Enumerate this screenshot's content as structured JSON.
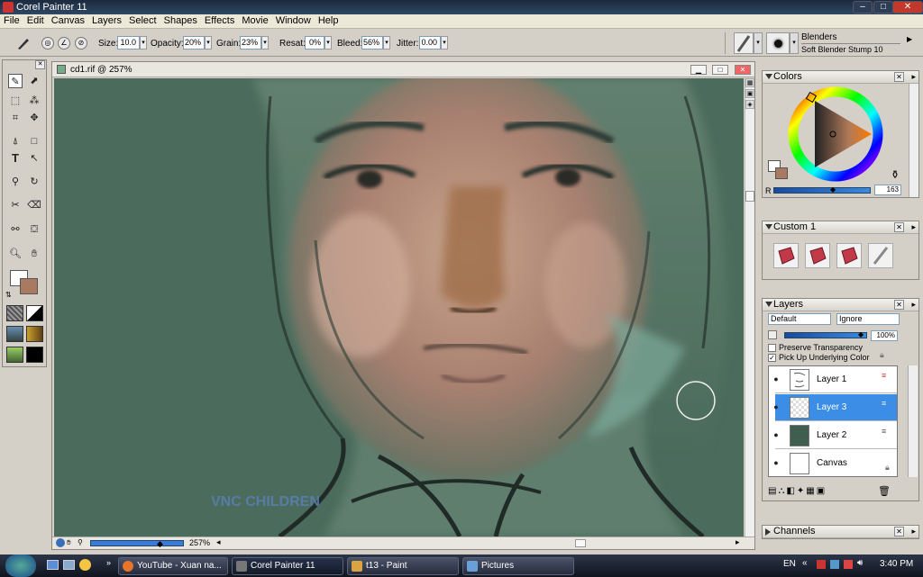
{
  "app": {
    "title": "Corel Painter 11"
  },
  "window_buttons": {
    "minimize": "–",
    "maximize": "□",
    "close": "✕"
  },
  "menu": [
    "File",
    "Edit",
    "Canvas",
    "Layers",
    "Select",
    "Shapes",
    "Effects",
    "Movie",
    "Window",
    "Help"
  ],
  "property_bar": {
    "size_label": "Size:",
    "size": "10.0",
    "opacity_label": "Opacity:",
    "opacity": "20%",
    "grain_label": "Grain:",
    "grain": "23%",
    "resat_label": "Resat:",
    "resat": "0%",
    "bleed_label": "Bleed:",
    "bleed": "56%",
    "jitter_label": "Jitter:",
    "jitter": "0.00",
    "brush_category": "Blenders",
    "brush_variant": "Soft Blender Stump 10"
  },
  "document": {
    "title": "cd1.rif @ 257%",
    "zoom": "257%",
    "watermark": "VNC CHILDREN"
  },
  "colors_panel": {
    "title": "Colors",
    "channel_label": "R",
    "channel_value": "163",
    "main_color": "#a87a62",
    "secondary_color": "#ffffff"
  },
  "custom_panel": {
    "title": "Custom  1"
  },
  "layers_panel": {
    "title": "Layers",
    "blend_mode": "Default",
    "composite": "Ignore",
    "opacity": "100%",
    "preserve_transparency": "Preserve Transparency",
    "pick_up_underlying": "Pick Up Underlying Color",
    "layers": [
      {
        "name": "Layer 1",
        "selected": false
      },
      {
        "name": "Layer 3",
        "selected": true
      },
      {
        "name": "Layer 2",
        "selected": false
      },
      {
        "name": "Canvas",
        "selected": false
      }
    ]
  },
  "channels_panel": {
    "title": "Channels"
  },
  "taskbar": {
    "items": [
      {
        "label": "YouTube - Xuan na..."
      },
      {
        "label": "Corel Painter 11"
      },
      {
        "label": "t13 - Paint"
      },
      {
        "label": "Pictures"
      }
    ],
    "language": "EN",
    "clock": "3:40 PM"
  },
  "colors": {
    "selection": "#3c8de6",
    "canvas_bg": "#4b6b5c"
  }
}
